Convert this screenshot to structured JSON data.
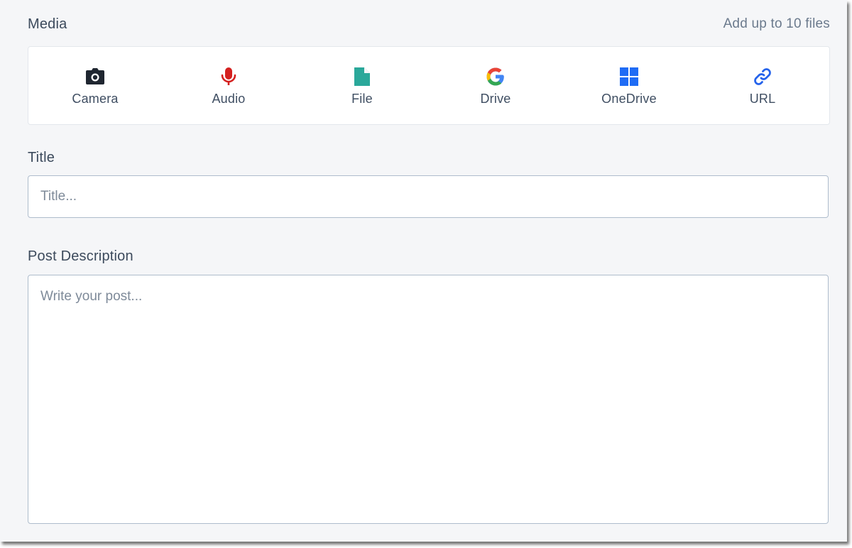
{
  "media": {
    "label": "Media",
    "hint": "Add up to 10 files",
    "options": [
      {
        "label": "Camera",
        "icon": "camera-icon",
        "color": "#1f2630"
      },
      {
        "label": "Audio",
        "icon": "microphone-icon",
        "color": "#d4201f"
      },
      {
        "label": "File",
        "icon": "file-icon",
        "color": "#2aa89a"
      },
      {
        "label": "Drive",
        "icon": "google-icon",
        "color": "#4285f4"
      },
      {
        "label": "OneDrive",
        "icon": "windows-icon",
        "color": "#1f6cf5"
      },
      {
        "label": "URL",
        "icon": "link-icon",
        "color": "#2563eb"
      }
    ]
  },
  "title": {
    "label": "Title",
    "placeholder": "Title...",
    "value": ""
  },
  "description": {
    "label": "Post Description",
    "placeholder": "Write your post...",
    "value": ""
  }
}
